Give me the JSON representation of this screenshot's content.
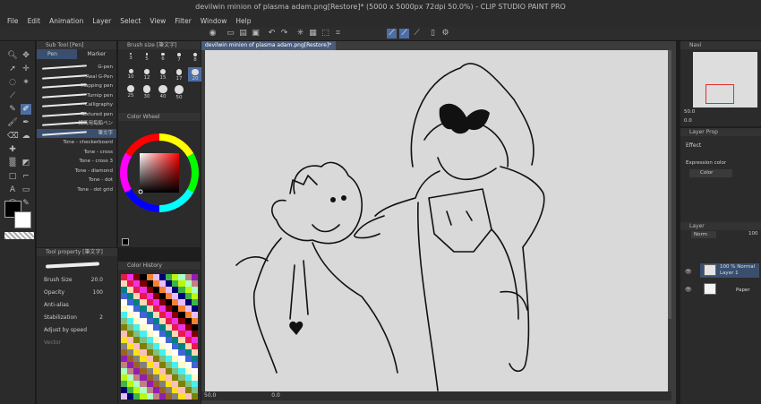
{
  "window": {
    "title": "devilwin minion of plasma adam.png[Restore]* (5000 x 5000px 72dpi 50.0%)  - CLIP STUDIO PAINT PRO"
  },
  "menu": [
    "File",
    "Edit",
    "Animation",
    "Layer",
    "Select",
    "View",
    "Filter",
    "Window",
    "Help"
  ],
  "subtool": {
    "header": "Sub Tool [Pen]",
    "tabs": [
      "Pen",
      "Marker"
    ],
    "brushes": [
      "G-pen",
      "Real G-Pen",
      "Mapping pen",
      "Turnip pen",
      "Calligraphy",
      "Textured pen",
      "練画用毎鉛ペン",
      "筆文字",
      "Tone - checkerboard",
      "Tone - cross",
      "Tone - cross 3",
      "Tone - diamond",
      "Tone - dot",
      "Tone - dot grid"
    ]
  },
  "brushsize": {
    "header": "Brush size [筆文字]",
    "sizes": [
      "3",
      "5",
      "6",
      "7",
      "8",
      "10",
      "12",
      "15",
      "17",
      "20",
      "25",
      "30",
      "40",
      "50"
    ],
    "selected": "20"
  },
  "colorwheel": {
    "header": "Color Wheel"
  },
  "toolprop": {
    "header": "Tool property [筆文字]",
    "brush_size_label": "Brush Size",
    "brush_size_value": "20.0",
    "opacity_label": "Opacity",
    "opacity_value": "100",
    "antialias_label": "Anti-alias",
    "stabilization_label": "Stabilization",
    "stabilization_value": "2",
    "adjust_label": "Adjust by speed",
    "vector_label": "Vector"
  },
  "colorhistory": {
    "header": "Color History"
  },
  "canvas": {
    "tab": "devilwin minion of plasma adam.png[Restore]*",
    "zoom": "50.0",
    "angle": "0.0"
  },
  "navigator": {
    "header": "Navi",
    "zoom": "50.0",
    "rotate": "0.0"
  },
  "layerprop": {
    "header": "Layer Prop",
    "effect_label": "Effect",
    "expression_label": "Expression color",
    "expression_value": "Color"
  },
  "layers": {
    "header": "Layer",
    "blend": "Norm",
    "opacity": "100",
    "items": [
      {
        "line1": "100 % Normal",
        "line2": "Layer 1"
      },
      {
        "line1": "",
        "line2": "Paper"
      }
    ]
  },
  "colors": {
    "accent": "#4d6da3",
    "canvas_bg": "#d9d9d9",
    "main_color": "#000000",
    "sub_color": "#ffffff"
  }
}
